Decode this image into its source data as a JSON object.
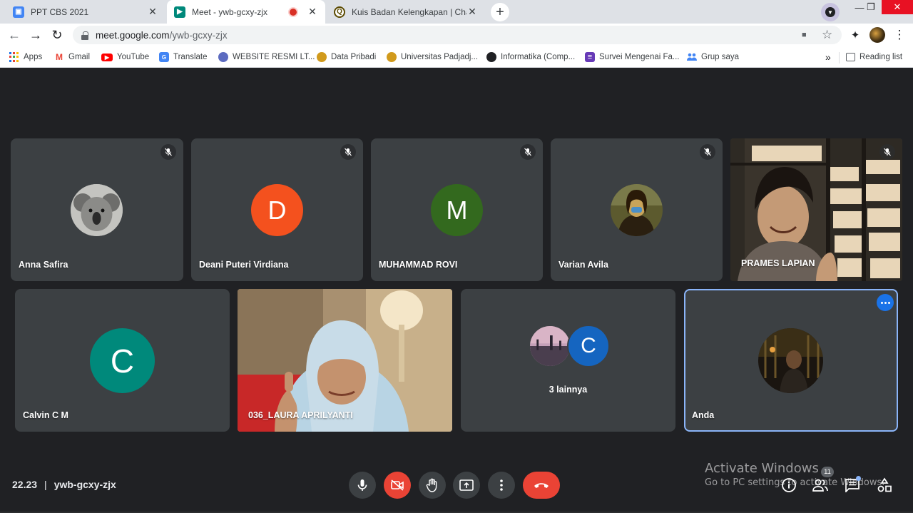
{
  "browser": {
    "tabs": [
      {
        "title": "PPT CBS 2021",
        "favicon_color": "#4285f4",
        "favicon_glyph": "▣",
        "active": false
      },
      {
        "title": "Meet - ywb-gcxy-zjx",
        "favicon_color": "#00897b",
        "favicon_glyph": "▶",
        "active": true
      },
      {
        "title": "Kuis Badan Kelengkapan | Charac",
        "favicon_color": "#5b4a00",
        "favicon_glyph": "Q",
        "active": false
      }
    ],
    "tab_close_glyph": "✕",
    "new_tab_glyph": "+",
    "window_controls": {
      "minimize": "—",
      "restore": "❐",
      "close": "✕"
    },
    "url": {
      "host": "meet.google.com",
      "path": "/ywb-gcxy-zjx"
    },
    "nav": {
      "back": "←",
      "forward": "→",
      "reload": "↻"
    },
    "toolbar_icons": {
      "camera": "■",
      "star": "☆",
      "extensions": "✦",
      "menu": "⋮"
    },
    "bookmarks": [
      {
        "label": "Apps",
        "icon": "apps-grid"
      },
      {
        "label": "Gmail",
        "icon": "gmail-icon",
        "color": "#ea4335",
        "glyph": "M"
      },
      {
        "label": "YouTube",
        "icon": "youtube-icon",
        "color": "#ff0000",
        "glyph": "▶"
      },
      {
        "label": "Translate",
        "icon": "translate-icon",
        "color": "#4285f4",
        "glyph": "G"
      },
      {
        "label": "WEBSITE RESMI LT...",
        "icon": "globe-icon",
        "color": "#5c6bc0",
        "glyph": "●"
      },
      {
        "label": "Data Pribadi",
        "icon": "unpad-icon",
        "color": "#d19a1c",
        "glyph": "◆"
      },
      {
        "label": "Universitas Padjadj...",
        "icon": "unpad-icon",
        "color": "#d19a1c",
        "glyph": "◆"
      },
      {
        "label": "Informatika (Comp...",
        "icon": "globe-icon",
        "color": "#202124",
        "glyph": "●"
      },
      {
        "label": "Survei Mengenai Fa...",
        "icon": "forms-icon",
        "color": "#673ab7",
        "glyph": "≡"
      },
      {
        "label": "Grup saya",
        "icon": "groups-icon",
        "color": "#4285f4",
        "glyph": "●"
      }
    ],
    "bookmarks_overflow": "»",
    "reading_list": "Reading list"
  },
  "meet": {
    "participants_row1": [
      {
        "name": "Anna Safira",
        "avatar_type": "photo",
        "avatar_desc": "koala",
        "muted": true
      },
      {
        "name": "Deani Puteri Virdiana",
        "avatar_type": "letter",
        "letter": "D",
        "color": "#f4511e",
        "muted": true
      },
      {
        "name": "MUHAMMAD ROVI",
        "avatar_type": "letter",
        "letter": "M",
        "color": "#33691e",
        "muted": true
      },
      {
        "name": "Varian Avila",
        "avatar_type": "photo",
        "avatar_desc": "mona-lisa",
        "muted": true
      },
      {
        "name": "PRAMES LAPIAN",
        "avatar_type": "video",
        "muted": true
      }
    ],
    "participants_row2": [
      {
        "name": "Calvin C M",
        "avatar_type": "letter",
        "letter": "C",
        "color": "#00897b"
      },
      {
        "name": "036_LAURA APRILYANTI",
        "avatar_type": "video"
      },
      {
        "name": "3 lainnya",
        "avatar_type": "group",
        "letter": "C",
        "color": "#1565c0"
      },
      {
        "name": "Anda",
        "avatar_type": "photo",
        "avatar_desc": "self",
        "self": true
      }
    ],
    "time": "22.23",
    "meeting_code": "ywb-gcxy-zjx",
    "participant_count": "11",
    "colors": {
      "end_call": "#ea4335",
      "camera_off": "#ea4335",
      "self_outline": "#8ab4f8"
    }
  },
  "watermark": {
    "line1": "Activate Windows",
    "line2": "Go to PC settings to activate Windows."
  }
}
